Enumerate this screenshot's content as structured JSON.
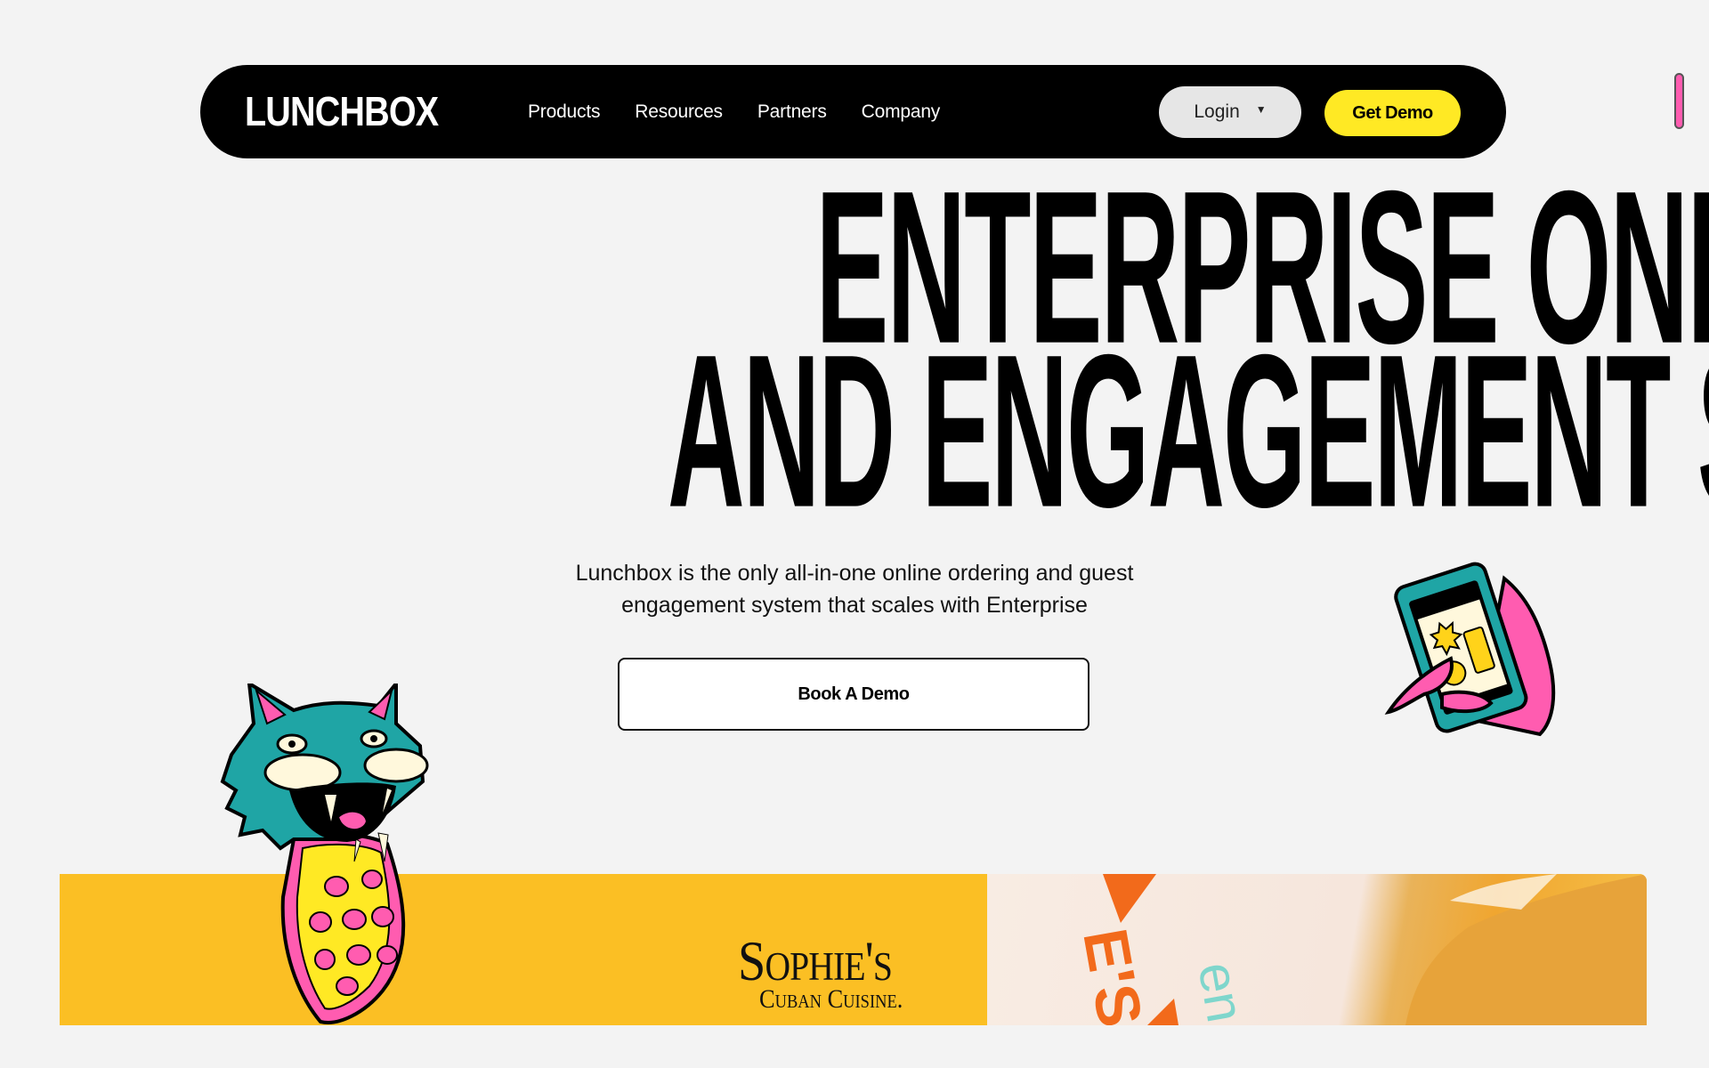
{
  "nav": {
    "logo": "LUNCHBOX",
    "links": [
      "Products",
      "Resources",
      "Partners",
      "Company"
    ],
    "login_label": "Login",
    "login_caret": "▼",
    "get_demo_label": "Get Demo"
  },
  "hero": {
    "headline_line1": "ENTERPRISE ONLINE ORDERING",
    "headline_line2": "AND ENGAGEMENT SUITE",
    "subtitle_line1": "Lunchbox is the only all-in-one online ordering and guest",
    "subtitle_line2": "engagement system that scales with Enterprise",
    "cta_label": "Book A Demo"
  },
  "banner": {
    "brand_name": "Sophie's",
    "brand_tagline": "Cuban Cuisine."
  },
  "colors": {
    "background": "#f3f3f3",
    "nav_bg": "#000000",
    "accent_yellow": "#ffe924",
    "banner_yellow": "#fbbf24",
    "pink": "#ff5cb0",
    "teal": "#1fa5a5"
  }
}
